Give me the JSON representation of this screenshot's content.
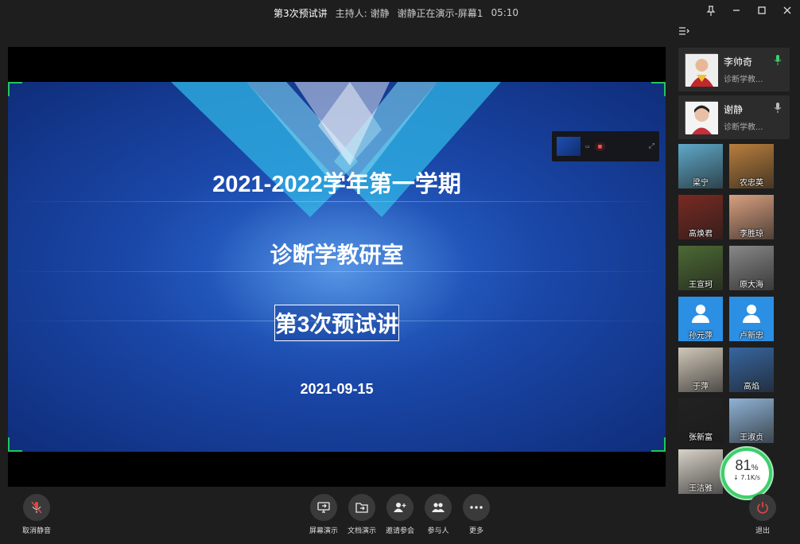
{
  "titlebar": {
    "meeting_title": "第3次预试讲",
    "host": "主持人: 谢静",
    "presenting": "谢静正在演示-屏幕1",
    "timer": "05:10"
  },
  "slide": {
    "line1": "2021-2022学年第一学期",
    "line2": "诊断学教研室",
    "line3": "第3次预试讲",
    "date": "2021-09-15"
  },
  "speakers": [
    {
      "name": "李帅奇",
      "sub": "诊断学教...",
      "mic_color": "#3ecf6a"
    },
    {
      "name": "谢静",
      "sub": "诊断学教...",
      "mic_color": "#bbbbbb"
    }
  ],
  "participants": [
    {
      "name": "梁宁",
      "bg": "#5fa9c9"
    },
    {
      "name": "农忠英",
      "bg": "#b87e3d"
    },
    {
      "name": "高焕君",
      "bg": "#7a2a22"
    },
    {
      "name": "李胜琼",
      "bg": "#d8a080"
    },
    {
      "name": "王宣珂",
      "bg": "#4d6a35"
    },
    {
      "name": "原大海",
      "bg": "#888888"
    },
    {
      "name": "孙元萍",
      "bg": "#2b8fe3",
      "default_avatar": true
    },
    {
      "name": "卢新忠",
      "bg": "#2b8fe3",
      "default_avatar": true
    },
    {
      "name": "于萍",
      "bg": "#cfc7b8"
    },
    {
      "name": "高焰",
      "bg": "#3766a0"
    },
    {
      "name": "张新富",
      "bg": "#222222"
    },
    {
      "name": "王淑贞",
      "bg": "#8fb3d6"
    },
    {
      "name": "王洁雅",
      "bg": "#d8d2c8"
    }
  ],
  "network": {
    "percent": "81",
    "unit": "%",
    "speed": "7.1K/s",
    "arrow": "↓"
  },
  "toolbar": {
    "mute": "取消静音",
    "screen": "屏幕演示",
    "doc": "文档演示",
    "invite": "邀请参会",
    "members": "参与人",
    "more": "更多",
    "leave": "退出",
    "leave_color": "#e04848"
  }
}
